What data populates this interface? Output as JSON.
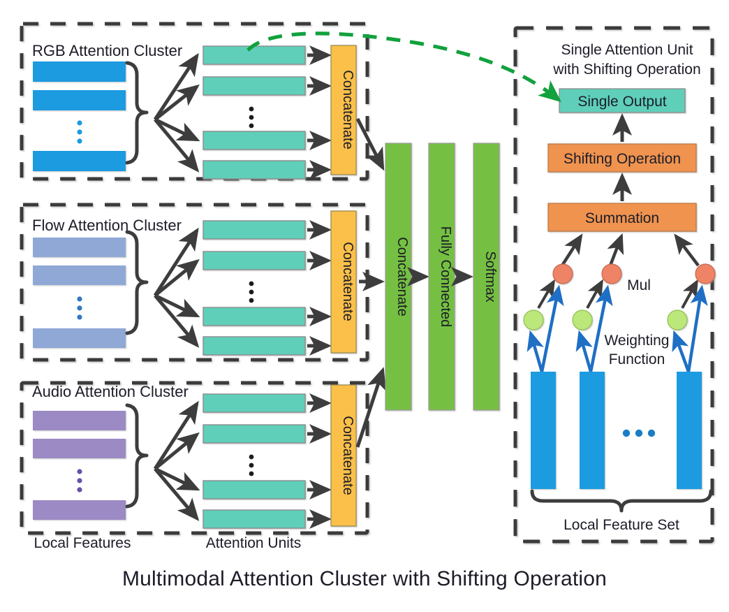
{
  "caption": "Multimodal Attention Cluster with Shifting Operation",
  "clusters": [
    {
      "id": "rgb",
      "title": "RGB Attention Cluster",
      "feature_color": "#1b9be0",
      "concatenate_label": "Concatenate",
      "attention_unit_count_shown": 4,
      "feature_count_shown": 3,
      "ellipsis": "⋮"
    },
    {
      "id": "flow",
      "title": "Flow Attention Cluster",
      "feature_color": "#8fa8d6",
      "concatenate_label": "Concatenate",
      "attention_unit_count_shown": 4,
      "feature_count_shown": 3,
      "ellipsis": "⋮"
    },
    {
      "id": "audio",
      "title": "Audio Attention Cluster",
      "feature_color": "#9b8ac4",
      "concatenate_label": "Concatenate",
      "attention_unit_count_shown": 4,
      "feature_count_shown": 3,
      "ellipsis": "⋮"
    }
  ],
  "axis_labels": {
    "local_features": "Local Features",
    "attention_units": "Attention Units"
  },
  "fusion_column": [
    {
      "id": "fusion-concatenate",
      "label": "Concatenate"
    },
    {
      "id": "fusion-fully-connected",
      "label": "Fully Connected"
    },
    {
      "id": "fusion-softmax",
      "label": "Softmax"
    }
  ],
  "right_panel": {
    "title_line1": "Single Attention Unit",
    "title_line2": "with Shifting Operation",
    "single_output": "Single Output",
    "shifting_operation": "Shifting Operation",
    "summation": "Summation",
    "mul": "Mul",
    "weighting_line1": "Weighting",
    "weighting_line2": "Function",
    "local_feature_set": "Local Feature Set",
    "feature_bars_shown": 3,
    "ellipsis": "•••"
  },
  "colors": {
    "teal": "#5ecfba",
    "orange_concat": "#fbc04a",
    "orange_op": "#ef9350",
    "green_fusion": "#74c043",
    "blue_feature": "#1b9be0",
    "blue_arrow": "#1f6fc4",
    "green_circle": "#bce77a",
    "red_circle": "#ef8365",
    "dashed_border": "#3b3b3b",
    "arrow_dark": "#3d3d3d",
    "green_dashed": "#11a13d",
    "text": "#1c1c28"
  }
}
